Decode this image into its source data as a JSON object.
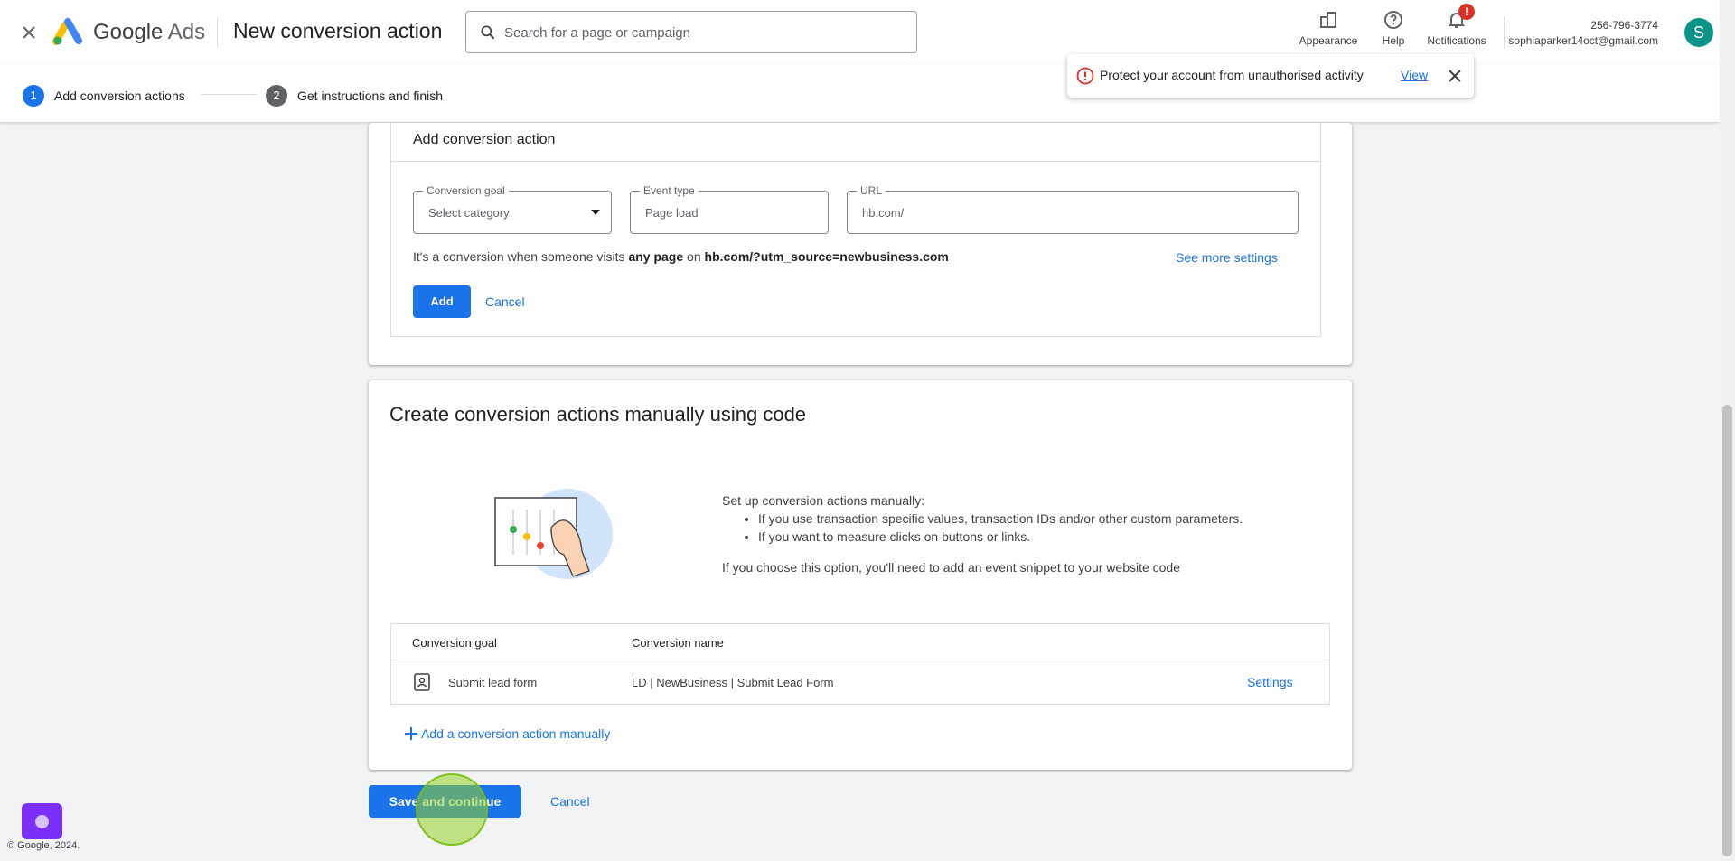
{
  "header": {
    "brand": "Google",
    "brand_suffix": "Ads",
    "page_title": "New conversion action",
    "search_placeholder": "Search for a page or campaign",
    "tools": [
      {
        "label": "Appearance",
        "icon": "appearance-icon"
      },
      {
        "label": "Help",
        "icon": "help-icon"
      },
      {
        "label": "Notifications",
        "icon": "bell-icon",
        "badge": "!"
      }
    ],
    "account": {
      "phone": "256-796-3774",
      "email": "sophiaparker14oct@gmail.com",
      "avatar_letter": "S"
    }
  },
  "steps": [
    {
      "number": "1",
      "label": "Add conversion actions",
      "active": true
    },
    {
      "number": "2",
      "label": "Get instructions and finish",
      "active": false
    }
  ],
  "toast": {
    "message": "Protect your account from unauthorised activity",
    "link": "View"
  },
  "add_section": {
    "title": "Add conversion action",
    "fields": {
      "goal": {
        "label": "Conversion goal",
        "value": "Select category"
      },
      "event": {
        "label": "Event type",
        "value": "Page load"
      },
      "url": {
        "label": "URL",
        "value": "hb.com/"
      }
    },
    "description": {
      "prefix": "It's a conversion when someone visits",
      "bold1": "any page",
      "middle": "on",
      "bold2": "hb.com/?utm_source=newbusiness.com"
    },
    "see_more": "See more settings",
    "add_button": "Add",
    "cancel": "Cancel"
  },
  "manual_section": {
    "title": "Create conversion actions manually using code",
    "setup_heading": "Set up conversion actions manually:",
    "bullets": [
      "If you use transaction specific values, transaction IDs and/or other custom parameters.",
      "If you want to measure clicks on buttons or links."
    ],
    "note": "If you choose this option, you'll need to add an event snippet to your website code",
    "table": {
      "headers": [
        "Conversion goal",
        "Conversion name"
      ],
      "row": {
        "goal": "Submit lead form",
        "name": "LD | NewBusiness | Submit Lead Form",
        "action": "Settings"
      }
    },
    "add_manually": "Add a conversion action manually"
  },
  "footer": {
    "save_button": "Save and continue",
    "cancel": "Cancel",
    "copyright": "© Google, 2024."
  },
  "colors": {
    "primary": "#1a73e8",
    "error": "#d93025",
    "avatar": "#0d9488"
  }
}
